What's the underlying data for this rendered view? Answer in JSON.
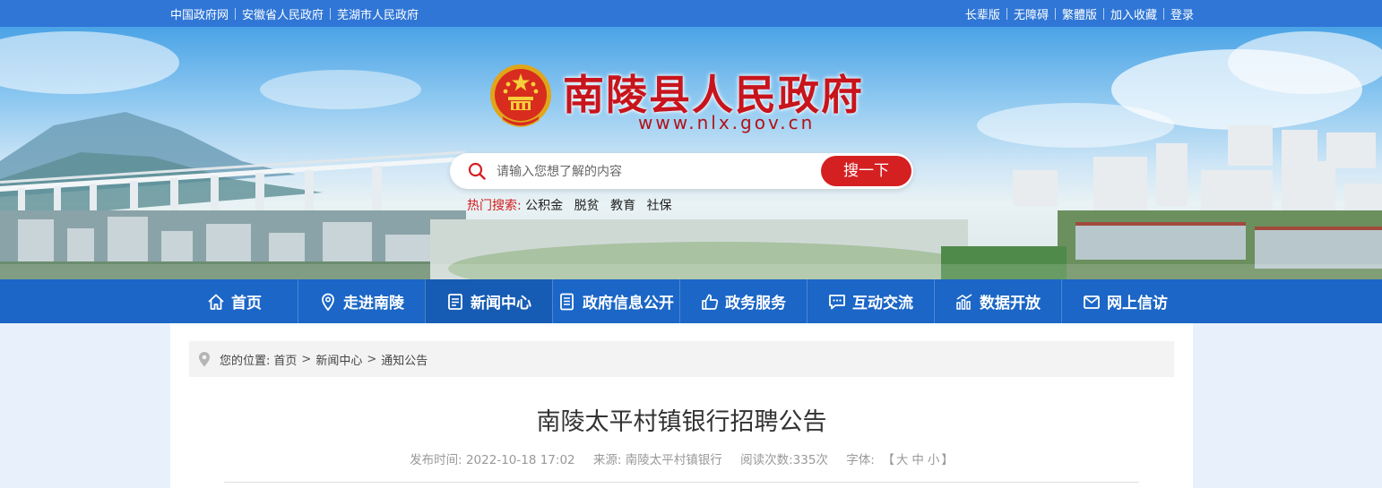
{
  "topbar": {
    "left_links": [
      "中国政府网",
      "安徽省人民政府",
      "芜湖市人民政府"
    ],
    "right_links": [
      "长辈版",
      "无障碍",
      "繁體版",
      "加入收藏",
      "登录"
    ]
  },
  "header": {
    "title": "南陵县人民政府",
    "url": "www.nlx.gov.cn"
  },
  "search": {
    "placeholder": "请输入您想了解的内容",
    "button": "搜一下",
    "hot_label": "热门搜索:",
    "hot_terms": [
      "公积金",
      "脱贫",
      "教育",
      "社保"
    ]
  },
  "nav": {
    "items": [
      {
        "label": "首页",
        "icon": "home-icon"
      },
      {
        "label": "走进南陵",
        "icon": "location-icon"
      },
      {
        "label": "新闻中心",
        "icon": "news-icon"
      },
      {
        "label": "政府信息公开",
        "icon": "document-icon"
      },
      {
        "label": "政务服务",
        "icon": "thumb-up-icon"
      },
      {
        "label": "互动交流",
        "icon": "chat-icon"
      },
      {
        "label": "数据开放",
        "icon": "chart-icon"
      },
      {
        "label": "网上信访",
        "icon": "mail-icon"
      }
    ],
    "active_index": 2
  },
  "breadcrumb": {
    "prefix": "您的位置:",
    "items": [
      "首页",
      "新闻中心",
      "通知公告"
    ],
    "separator": ">"
  },
  "article": {
    "title": "南陵太平村镇银行招聘公告",
    "publish_label": "发布时间:",
    "publish_time": "2022-10-18 17:02",
    "source_label": "来源:",
    "source": "南陵太平村镇银行",
    "views_label": "阅读次数:",
    "views": "335次",
    "font_label": "字体:",
    "font_open": "【",
    "font_sizes": [
      "大",
      "中",
      "小"
    ],
    "font_close": "】"
  },
  "colors": {
    "topbar": "#2f76d6",
    "nav": "#1b66c6",
    "title_red": "#c8141c",
    "search_button": "#d52022"
  }
}
